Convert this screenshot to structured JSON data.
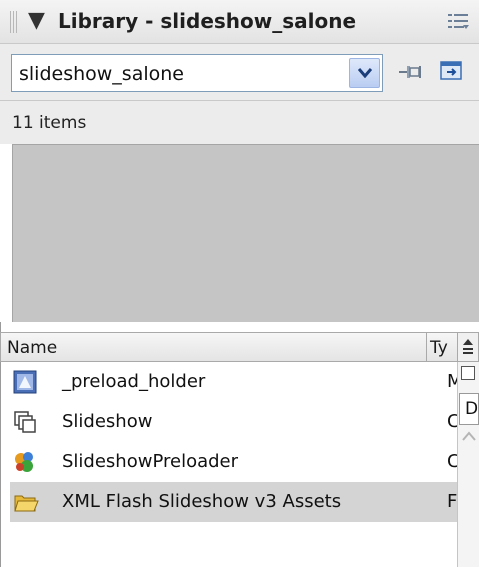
{
  "panel": {
    "title": "Library - slideshow_salone",
    "collapse_glyph": "▼"
  },
  "document_select": {
    "value": "slideshow_salone"
  },
  "item_count": "11 items",
  "columns": {
    "name": "Name",
    "type": "Ty",
    "sort_glyph": "≜"
  },
  "items": [
    {
      "name": "_preload_holder",
      "type": "M",
      "icon": "movieclip-icon",
      "selected": false
    },
    {
      "name": "Slideshow",
      "type": "C",
      "icon": "component-icon",
      "selected": false
    },
    {
      "name": "SlideshowPreloader",
      "type": "C",
      "icon": "component-icon",
      "selected": false
    },
    {
      "name": "XML Flash Slideshow v3 Assets",
      "type": "F",
      "icon": "folder-icon",
      "selected": true
    }
  ],
  "scrollbar": {
    "label": "D"
  },
  "colors": {
    "selected_row": "#d4d4d4",
    "preview_bg": "#c5c5c5",
    "select_border": "#7f9db9"
  }
}
